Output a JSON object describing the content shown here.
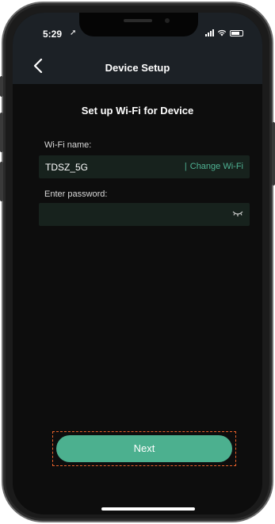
{
  "status_bar": {
    "time": "5:29",
    "location_icon": "location-arrow-icon",
    "signal_icon": "cellular-signal-icon",
    "wifi_icon": "wifi-icon",
    "battery_icon": "battery-icon"
  },
  "header": {
    "back_icon": "chevron-left-icon",
    "back_glyph": "‹",
    "title": "Device Setup"
  },
  "main": {
    "heading": "Set up Wi-Fi for Device",
    "wifi_label": "Wi-Fi name:",
    "wifi_value": "TDSZ_5G",
    "change_separator": "|",
    "change_wifi_label": "Change Wi-Fi",
    "password_label": "Enter password:",
    "password_value": "",
    "password_toggle_icon": "eye-closed-icon"
  },
  "footer": {
    "next_label": "Next"
  },
  "colors": {
    "accent": "#4cb08f",
    "link": "#4fb394",
    "highlight_border": "#e8612a",
    "field_bg": "#17221d",
    "header_bg": "#1c2126",
    "screen_bg": "#0d0d0d"
  }
}
